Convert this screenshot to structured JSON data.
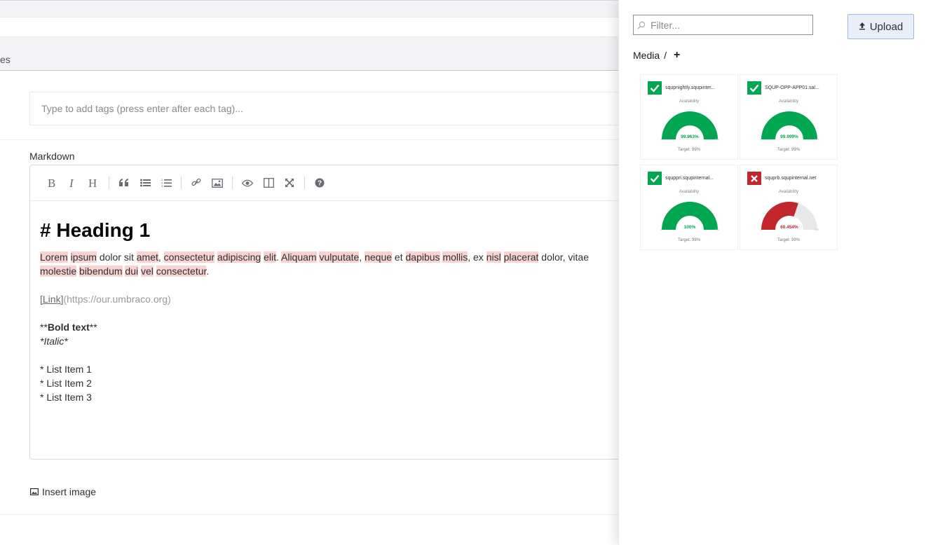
{
  "tab_partial": "es",
  "tags": {
    "placeholder": "Type to add tags (press enter after each tag)..."
  },
  "markdown": {
    "label": "Markdown",
    "toolbar": [
      "bold-icon",
      "italic-icon",
      "heading-icon",
      "quote-icon",
      "unordered-list-icon",
      "ordered-list-icon",
      "link-icon",
      "image-icon",
      "preview-icon",
      "side-by-side-icon",
      "fullscreen-icon",
      "help-icon"
    ],
    "heading": "# Heading 1",
    "para_line1": [
      {
        "t": "Lorem",
        "hl": true
      },
      {
        "t": " ",
        "hl": false
      },
      {
        "t": "ipsum",
        "hl": true
      },
      {
        "t": " dolor sit ",
        "hl": false
      },
      {
        "t": "amet",
        "hl": true
      },
      {
        "t": ", ",
        "hl": false
      },
      {
        "t": "consectetur",
        "hl": true
      },
      {
        "t": " ",
        "hl": false
      },
      {
        "t": "adipiscing",
        "hl": true
      },
      {
        "t": " ",
        "hl": false
      },
      {
        "t": "elit",
        "hl": true
      },
      {
        "t": ". ",
        "hl": false
      },
      {
        "t": "Aliquam",
        "hl": true
      },
      {
        "t": " ",
        "hl": false
      },
      {
        "t": "vulputate",
        "hl": true
      },
      {
        "t": ", ",
        "hl": false
      },
      {
        "t": "neque",
        "hl": true
      },
      {
        "t": " et ",
        "hl": false
      },
      {
        "t": "dapibus",
        "hl": true
      },
      {
        "t": " ",
        "hl": false
      },
      {
        "t": "mollis",
        "hl": true
      },
      {
        "t": ", ex ",
        "hl": false
      },
      {
        "t": "nisl",
        "hl": true
      },
      {
        "t": " ",
        "hl": false
      },
      {
        "t": "placerat",
        "hl": true
      },
      {
        "t": " dolor, vitae",
        "hl": false
      }
    ],
    "para_line2": [
      {
        "t": "molestie",
        "hl": true
      },
      {
        "t": " ",
        "hl": false
      },
      {
        "t": "bibendum",
        "hl": true
      },
      {
        "t": " ",
        "hl": false
      },
      {
        "t": "dui",
        "hl": true
      },
      {
        "t": " ",
        "hl": false
      },
      {
        "t": "vel",
        "hl": true
      },
      {
        "t": " ",
        "hl": false
      },
      {
        "t": "consectetur",
        "hl": true
      },
      {
        "t": ".",
        "hl": false
      }
    ],
    "link_text": "[Link]",
    "link_url": "(https://our.umbraco.org)",
    "bold_open": "**",
    "bold_text": "Bold text",
    "bold_close": "**",
    "italic": "*Italic*",
    "list": [
      "* List Item 1",
      "* List Item 2",
      "* List Item 3"
    ]
  },
  "insert_image": "Insert image",
  "panel": {
    "filter_placeholder": "Filter...",
    "upload_label": "Upload",
    "crumb_root": "Media",
    "crumb_sep": "/",
    "crumb_add": "+"
  },
  "media_tiles": [
    {
      "name": "squpnightly.squpinter...",
      "status": "ok",
      "avail_label": "Availability",
      "value": 99.963,
      "value_label": "99.963%",
      "min": "0",
      "max": "100",
      "target": "Target: 99%",
      "color": "#00a651"
    },
    {
      "name": "SQUP-OPP-APP01.sal...",
      "status": "ok",
      "avail_label": "Availability",
      "value": 99.999,
      "value_label": "99.999%",
      "min": "0",
      "max": "100",
      "target": "Target: 99%",
      "color": "#00a651"
    },
    {
      "name": "squppri.squpinternal...",
      "status": "ok",
      "avail_label": "Availability",
      "value": 100,
      "value_label": "100%",
      "min": "0",
      "max": "100",
      "target": "Target: 99%",
      "color": "#00a651"
    },
    {
      "name": "squprb.squpinternal.net",
      "status": "fail",
      "avail_label": "Availability",
      "value": 60.454,
      "value_label": "60.454%",
      "min": "0",
      "max": "100",
      "target": "Target: 99%",
      "color": "#c1272d"
    }
  ]
}
